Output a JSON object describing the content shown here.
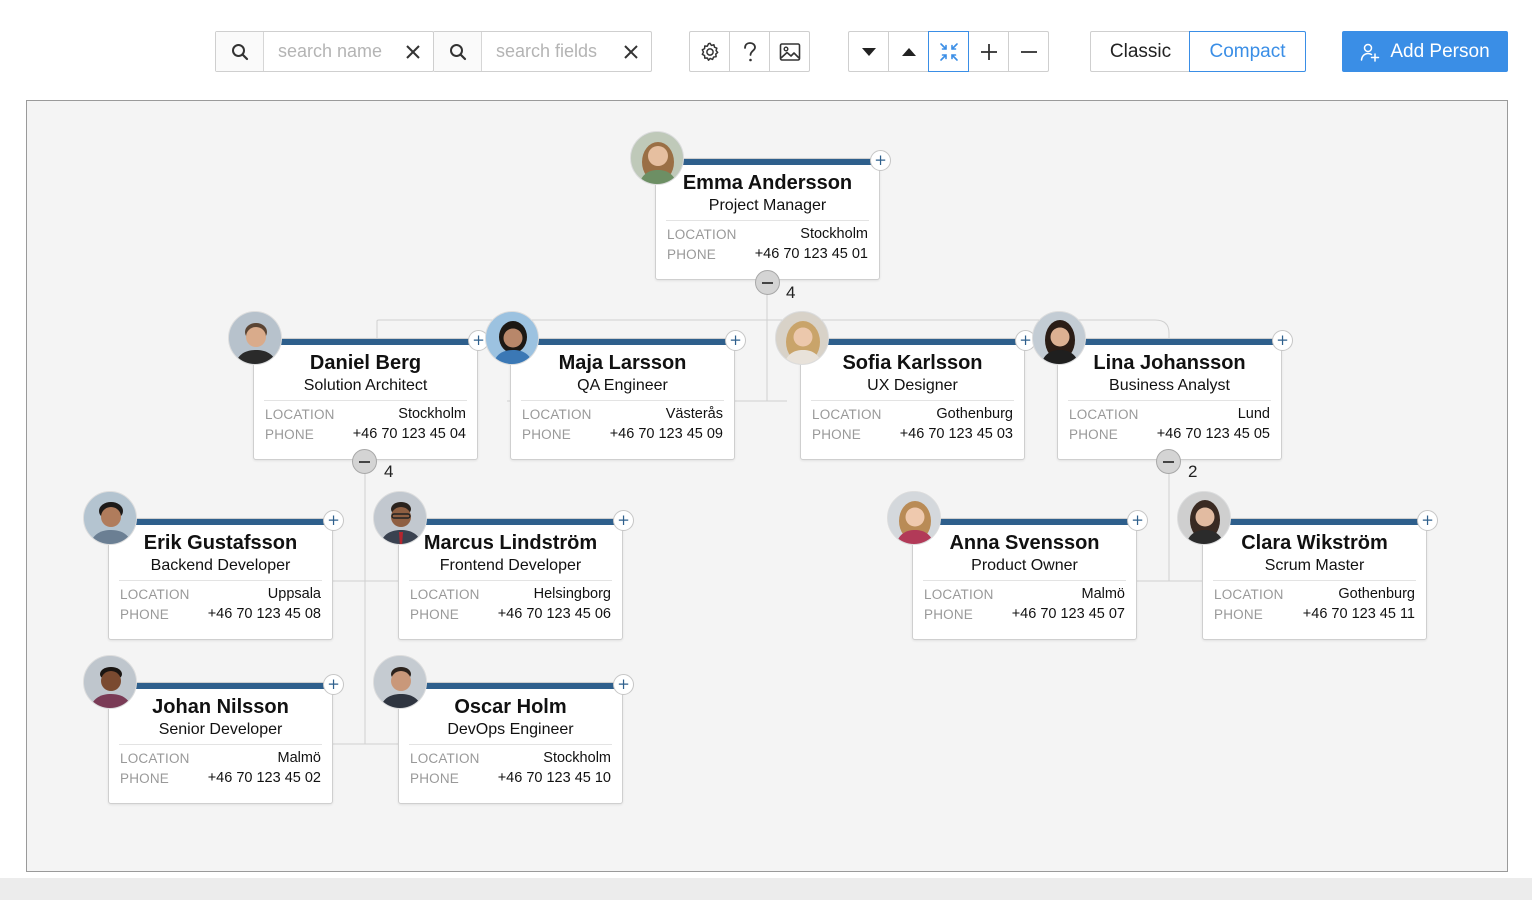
{
  "toolbar": {
    "search_name": {
      "placeholder": "search name",
      "value": ""
    },
    "search_fields": {
      "placeholder": "search fields",
      "value": ""
    },
    "layout_options": {
      "classic": "Classic",
      "compact": "Compact",
      "selected": "Compact"
    },
    "add_person_label": "Add Person",
    "accent_color": "#3a8ee6"
  },
  "people": {
    "emma": {
      "name": "Emma Andersson",
      "title": "Project Manager",
      "location": "Stockholm",
      "phone": "+46 70 123 45 01"
    },
    "daniel": {
      "name": "Daniel Berg",
      "title": "Solution Architect",
      "location": "Stockholm",
      "phone": "+46 70 123 45 04"
    },
    "maja": {
      "name": "Maja Larsson",
      "title": "QA Engineer",
      "location": "Västerås",
      "phone": "+46 70 123 45 09"
    },
    "sofia": {
      "name": "Sofia Karlsson",
      "title": "UX Designer",
      "location": "Gothenburg",
      "phone": "+46 70 123 45 03"
    },
    "lina": {
      "name": "Lina Johansson",
      "title": "Business Analyst",
      "location": "Lund",
      "phone": "+46 70 123 45 05"
    },
    "erik": {
      "name": "Erik Gustafsson",
      "title": "Backend Developer",
      "location": "Uppsala",
      "phone": "+46 70 123 45 08"
    },
    "marcus": {
      "name": "Marcus Lindström",
      "title": "Frontend Developer",
      "location": "Helsingborg",
      "phone": "+46 70 123 45 06"
    },
    "anna": {
      "name": "Anna Svensson",
      "title": "Product Owner",
      "location": "Malmö",
      "phone": "+46 70 123 45 07"
    },
    "clara": {
      "name": "Clara Wikström",
      "title": "Scrum Master",
      "location": "Gothenburg",
      "phone": "+46 70 123 45 11"
    },
    "johan": {
      "name": "Johan Nilsson",
      "title": "Senior Developer",
      "location": "Malmö",
      "phone": "+46 70 123 45 02"
    },
    "oscar": {
      "name": "Oscar Holm",
      "title": "DevOps Engineer",
      "location": "Stockholm",
      "phone": "+46 70 123 45 10"
    }
  },
  "field_labels": {
    "location": "LOCATION",
    "phone": "PHONE"
  },
  "child_counts": {
    "emma": "4",
    "daniel": "4",
    "lina": "2"
  },
  "colors": {
    "card_bar": "#2e5f8c",
    "canvas_bg": "#f4f4f4"
  }
}
